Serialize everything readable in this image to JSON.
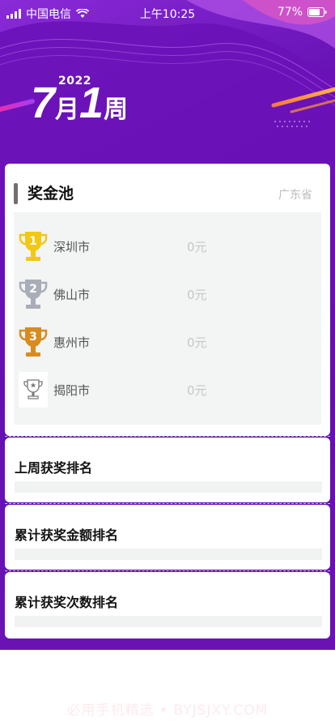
{
  "status_bar": {
    "carrier": "中国电信",
    "time": "上午10:25",
    "battery": "77%"
  },
  "header": {
    "year": "2022",
    "month_num": "7",
    "month_unit": "月",
    "week_num": "1",
    "week_unit": "周"
  },
  "prize_pool": {
    "title": "奖金池",
    "province": "广东省",
    "rows": [
      {
        "rank": "1",
        "city": "深圳市",
        "amount": "0元",
        "trophy": "gold-trophy-icon",
        "color": "#f2c814"
      },
      {
        "rank": "2",
        "city": "佛山市",
        "amount": "0元",
        "trophy": "silver-trophy-icon",
        "color": "#a9adb8"
      },
      {
        "rank": "3",
        "city": "惠州市",
        "amount": "0元",
        "trophy": "bronze-trophy-icon",
        "color": "#d98b1e"
      },
      {
        "rank": "",
        "city": "揭阳市",
        "amount": "0元",
        "trophy": "outline-trophy-icon",
        "color": "#777777"
      }
    ]
  },
  "sections": [
    {
      "title": "上周获奖排名"
    },
    {
      "title": "累计获奖金额排名"
    },
    {
      "title": "累计获奖次数排名"
    }
  ],
  "footer": {
    "watermark": "必用手机精选 • BYJSJXY.COM"
  },
  "colors": {
    "background_purple": "#6a10b8",
    "accent_pink": "#e23ab7",
    "accent_orange": "#f08a3b"
  }
}
